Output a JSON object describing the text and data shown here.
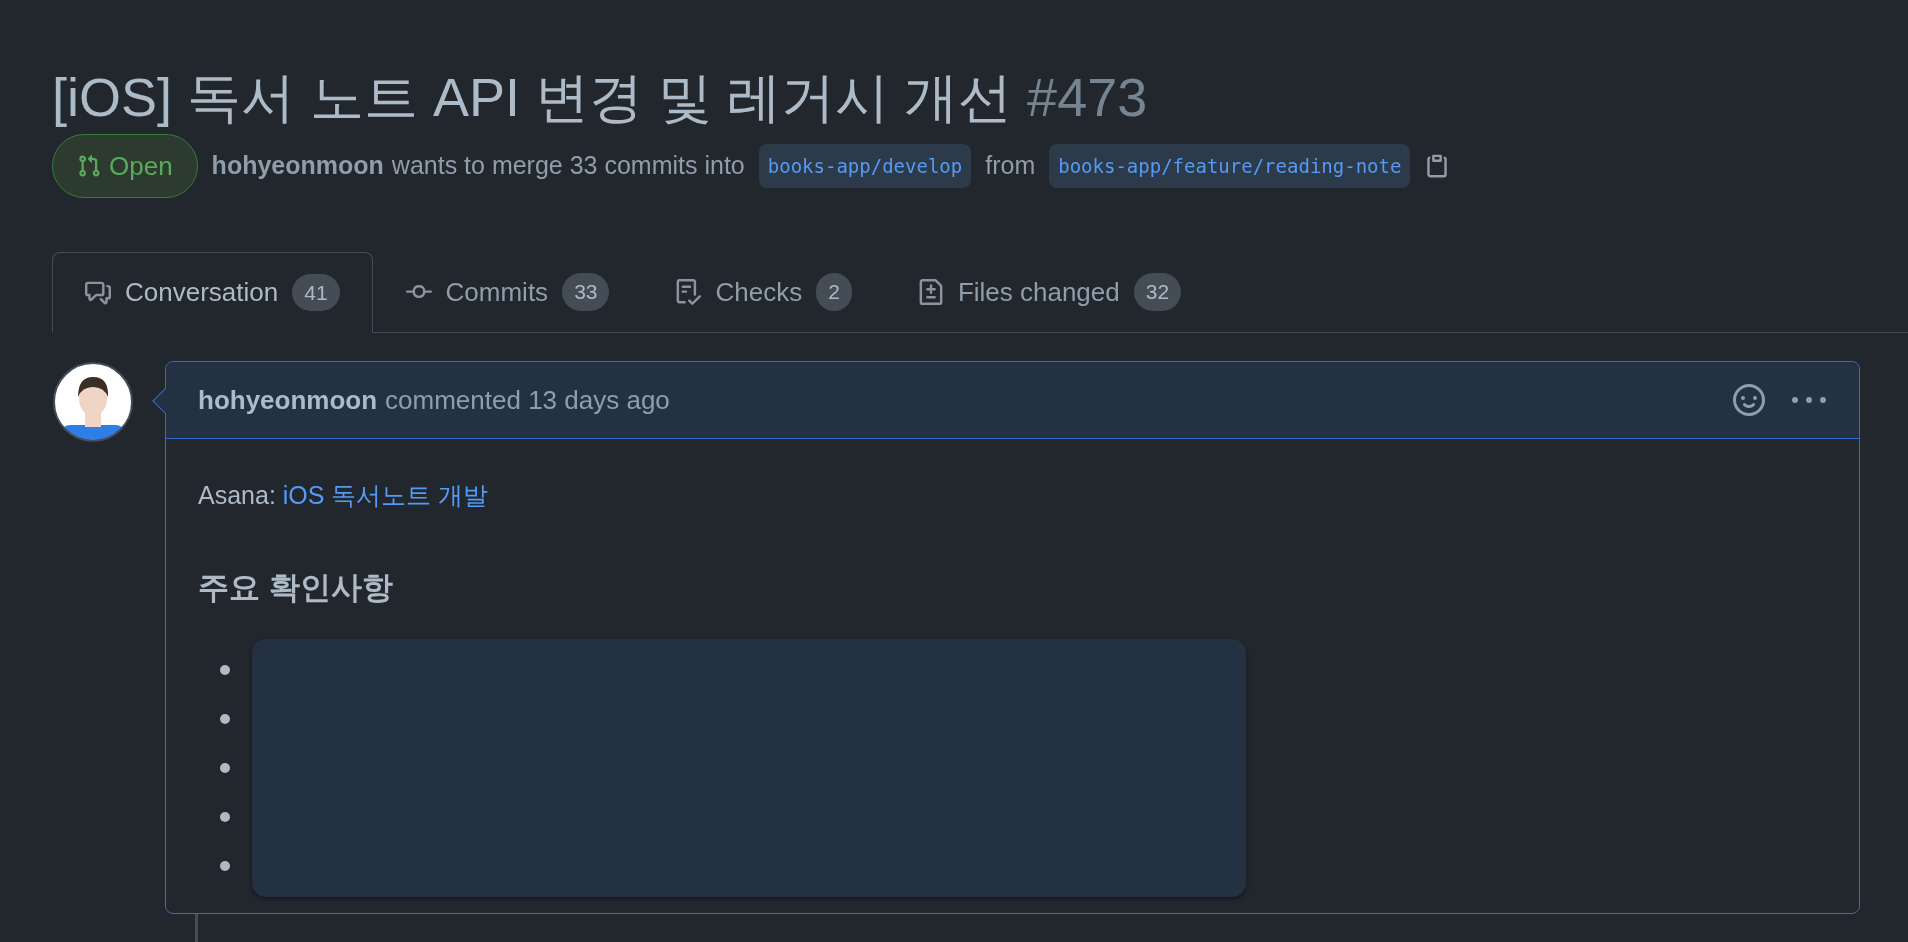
{
  "title": {
    "text": "[iOS] 독서 노트 API 변경 및 레거시 개선",
    "number": "#473"
  },
  "status": {
    "state_label": "Open",
    "author": "hohyeonmoon",
    "merge_text": "wants to merge 33 commits into",
    "base_branch": "books-app/develop",
    "from_text": "from",
    "head_branch": "books-app/feature/reading-note"
  },
  "tabs": [
    {
      "label": "Conversation",
      "count": "41",
      "selected": true,
      "kind": "conversation"
    },
    {
      "label": "Commits",
      "count": "33",
      "selected": false,
      "kind": "commits"
    },
    {
      "label": "Checks",
      "count": "2",
      "selected": false,
      "kind": "checks"
    },
    {
      "label": "Files changed",
      "count": "32",
      "selected": false,
      "kind": "files"
    }
  ],
  "comment": {
    "author": "hohyeonmoon",
    "meta": "commented 13 days ago",
    "link_prefix": "Asana:",
    "link_text": "iOS 독서노트 개발",
    "heading": "주요 확인사항",
    "list_items": [
      {
        "kind": "redacted"
      },
      {
        "kind": "redacted"
      },
      {
        "kind": "redacted"
      },
      {
        "kind": "redacted"
      },
      {
        "kind": "redacted"
      }
    ]
  }
}
